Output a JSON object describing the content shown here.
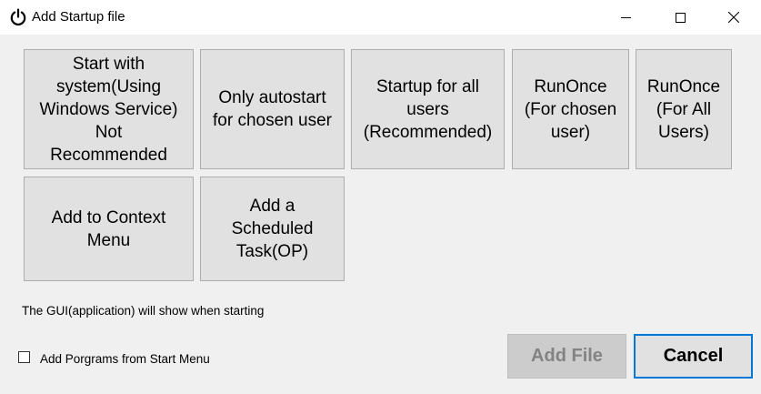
{
  "window": {
    "title": "Add Startup file",
    "icon": "power-icon",
    "controls": [
      "minimize-icon",
      "maximize-icon",
      "close-icon"
    ]
  },
  "options": {
    "row1": [
      {
        "label": "Start with\nsystem(Using\nWindows Service)\nNot\nRecommended"
      },
      {
        "label": "Only autostart\nfor chosen user"
      },
      {
        "label": "Startup for all\nusers\n(Recommended)"
      },
      {
        "label": "RunOnce\n(For chosen\nuser)"
      },
      {
        "label": "RunOnce\n(For All\nUsers)"
      }
    ],
    "row2": [
      {
        "label": "Add to Context\nMenu"
      },
      {
        "label": "Add a\nScheduled\nTask(OP)"
      }
    ]
  },
  "status_text": "The GUI(application) will show when starting",
  "checkbox": {
    "label": "Add Porgrams from Start Menu",
    "checked": false
  },
  "actions": {
    "add_file": "Add File",
    "cancel": "Cancel"
  },
  "colors": {
    "accent": "#0078d7",
    "button_face": "#e1e1e1",
    "disabled_text": "#838383"
  }
}
